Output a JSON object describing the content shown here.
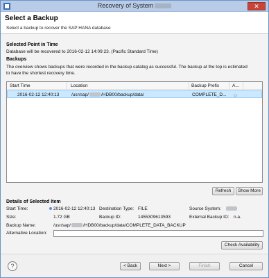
{
  "window": {
    "title": "Recovery of System",
    "close_label": "✕"
  },
  "header": {
    "title": "Select a Backup",
    "subtitle": "Select a backup to recover the SAP HANA database"
  },
  "point_in_time": {
    "heading": "Selected Point in Time",
    "text": "Database will be recovered to 2016-02-12 14:09:23. (Pacific Standard Time)"
  },
  "backups": {
    "heading": "Backups",
    "description_line1": "The overview shows backups that were recorded in the backup catalog as successful. The backup at the top is estimated",
    "description_line2": "to have the shortest recovery time.",
    "columns": {
      "start_time": "Start Time",
      "location": "Location",
      "backup_prefix": "Backup Prefix",
      "availability": "A..."
    },
    "rows": [
      {
        "start_time": "2016-02-12 12:40:13",
        "location_prefix": "/usr/sap/",
        "location_suffix": "/HDB00/backup/data/",
        "backup_prefix": "COMPLETE_D...",
        "availability": "◇"
      }
    ]
  },
  "buttons": {
    "refresh": "Refresh",
    "show_more": "Show More",
    "check_availability": "Check Availability",
    "back": "< Back",
    "next": "Next >",
    "finish": "Finish",
    "cancel": "Cancel"
  },
  "details": {
    "heading": "Details of Selected Item",
    "start_time_label": "Start Time:",
    "start_time_value": "2016-02-12 12:40:13",
    "destination_type_label": "Destination Type:",
    "destination_type_value": "FILE",
    "source_system_label": "Source System:",
    "size_label": "Size:",
    "size_value": "1.72 GB",
    "backup_id_label": "Backup ID:",
    "backup_id_value": "1455309613593",
    "external_backup_id_label": "External Backup ID:",
    "external_backup_id_value": "n.a.",
    "backup_name_label": "Backup Name:",
    "backup_name_prefix": "/usr/sap/",
    "backup_name_suffix": "/HDB00/backup/data/COMPLETE_DATA_BACKUP",
    "alternative_location_label": "Alternative Location:",
    "alternative_location_value": ""
  },
  "help": {
    "icon_label": "?"
  }
}
